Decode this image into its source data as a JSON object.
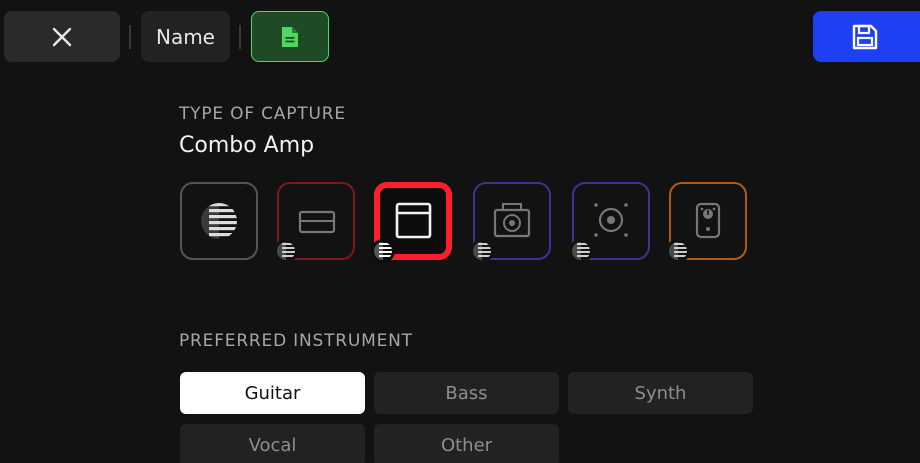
{
  "toolbar": {
    "close_icon": "close-icon",
    "name_label": "Name",
    "file_icon": "document-icon",
    "save_icon": "save-icon"
  },
  "capture": {
    "title": "TYPE OF CAPTURE",
    "value": "Combo Amp",
    "types": [
      {
        "icon": "full-rig-icon",
        "color": "#555555",
        "selected": false
      },
      {
        "icon": "amp-head-icon",
        "color": "#7a1a1a",
        "selected": false
      },
      {
        "icon": "combo-amp-icon",
        "color": "#ff1f2a",
        "selected": true
      },
      {
        "icon": "cabinet-icon",
        "color": "#3b3490",
        "selected": false
      },
      {
        "icon": "speaker-icon",
        "color": "#3b3490",
        "selected": false
      },
      {
        "icon": "pedal-icon",
        "color": "#b05a16",
        "selected": false
      }
    ]
  },
  "instrument": {
    "title": "PREFERRED INSTRUMENT",
    "options": [
      "Guitar",
      "Bass",
      "Synth",
      "Vocal",
      "Other"
    ],
    "selected": "Guitar"
  },
  "colors": {
    "background": "#121212",
    "accent_blue": "#1f3ff2",
    "accent_green": "#4ed860",
    "selected_red": "#ff1f2a"
  }
}
